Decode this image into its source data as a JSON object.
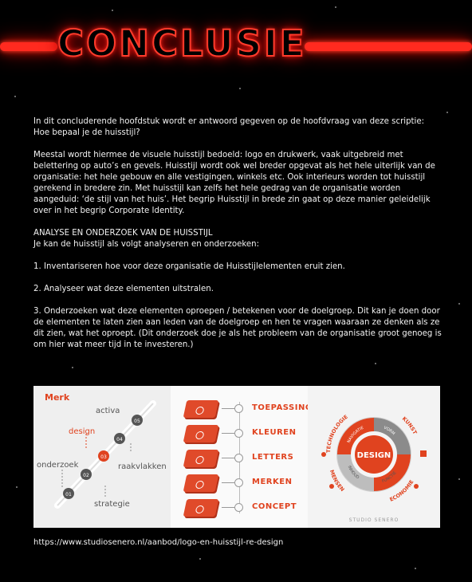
{
  "title": "CONCLUSIE",
  "intro": {
    "line1": "In dit concluderende hoofdstuk wordt er antwoord gegeven op de hoofdvraag van deze scriptie:",
    "line2": "Hoe bepaal je de huisstijl?"
  },
  "paragraph": "Meestal wordt hiermee de visuele huisstijl bedoeld: logo en drukwerk, vaak uitgebreid met belettering op auto’s en gevels. Huisstijl wordt ook wel breder opgevat als het hele uiterlijk van de organisatie: het hele gebouw en alle vestigingen, winkels etc. Ook interieurs worden tot huisstijl gerekend in bredere zin. Met huisstijl kan zelfs het hele gedrag van de organisatie worden aangeduid: ‘de stijl van het huis’. Het begrip Huisstijl in brede zin gaat op deze manier geleidelijk over in het begrip Corporate Identity.",
  "analysis": {
    "heading": "ANALYSE EN ONDERZOEK VAN DE HUISSTIJL",
    "subheading": "Je kan de huisstijl als volgt analyseren en onderzoeken:",
    "step1": "1. Inventariseren hoe voor deze organisatie de Huisstijlelementen eruit zien.",
    "step2": "2. Analyseer wat deze elementen uitstralen.",
    "step3": "3. Onderzoeken wat deze elementen oproepen / betekenen voor de doelgroep. Dit kan je doen door de elementen te laten zien aan leden van de doelgroep en hen te vragen waaraan ze denken als ze dit zien, wat het oproept. (Dit onderzoek doe je als het probleem van de organisatie groot genoeg is om hier wat meer tijd in te investeren.)"
  },
  "graphic": {
    "merk": "Merk",
    "words": [
      "activa",
      "design",
      "onderzoek",
      "raakvlakken",
      "strategie"
    ],
    "numbers": [
      "01",
      "02",
      "03",
      "04",
      "05"
    ],
    "list": [
      "TOEPASSINGEN",
      "KLEUREN",
      "LETTERS",
      "MERKEN",
      "CONCEPT"
    ],
    "wheel": {
      "center": "DESIGN",
      "inner": [
        "NAVIGATIE",
        "VORM",
        "FUNCTIE",
        "INHOUD"
      ],
      "outer": [
        "TECHNOLOGIE",
        "KUNST",
        "ECONOMIE",
        "MENSEN"
      ],
      "brand": "STUDIO SENERO"
    }
  },
  "url": "https://www.studiosenero.nl/aanbod/logo-en-huisstijl-re-design",
  "colors": {
    "neon": "#ff2a1f",
    "accent": "#e0431f",
    "background": "#000000"
  }
}
